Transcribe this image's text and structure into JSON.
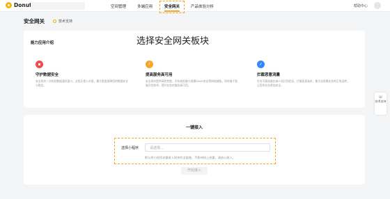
{
  "header": {
    "brand": "Donut",
    "nav": [
      {
        "label": "空间管理"
      },
      {
        "label": "多端应用"
      },
      {
        "label": "安全网关",
        "active": true
      },
      {
        "label": "产品体验分析"
      }
    ],
    "help": "帮助中心"
  },
  "page": {
    "title": "安全网关",
    "tech_support": "技术支持",
    "annotation": "选择安全网关板块"
  },
  "capabilities": {
    "title": "能力应用介绍",
    "items": [
      {
        "icon": "shield-lock-icon",
        "color": "#f24b4b",
        "title": "守护数据安全",
        "desc": "安全网关二次校验数据通讯接口，全程无侵入对接，最大限度保障您的数据安全与稳定。"
      },
      {
        "icon": "lightning-icon",
        "color": "#f5a623",
        "title": "提高服务高可用",
        "desc": "安全网关提供高防性能，可有效抵御大规模DDoS攻击等网络威胁，同时基于智能识别技术，提升业务的服务高可用。"
      },
      {
        "icon": "shield-check-icon",
        "color": "#2f88ff",
        "title": "拦截恶意流量",
        "desc": "针对可疑流量实施人机识别验证，拦截恶意请求，最大化保障业务的正常运转，让您的业务更加安全。"
      }
    ]
  },
  "access": {
    "title": "一键接入",
    "select_label": "选择小程序",
    "select_placeholder": "请选择...",
    "hint": "默认将小程序流量接入网关的全链路，不影响线上流量，请放心接入。",
    "start_button": "开始接入"
  },
  "side_tab": {
    "label": "技术支持"
  },
  "colors": {
    "accent": "#f5a623"
  }
}
